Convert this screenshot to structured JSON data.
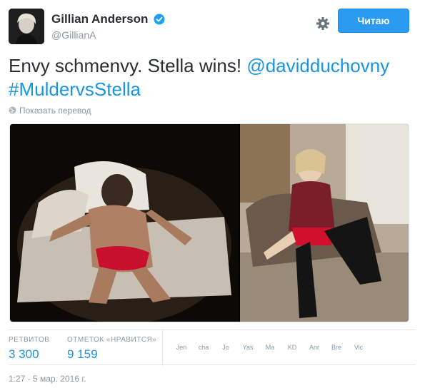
{
  "user": {
    "display_name": "Gillian Anderson",
    "handle": "@GillianA",
    "verified": true
  },
  "follow_button": {
    "label": "Читаю"
  },
  "tweet": {
    "text_plain": "Envy schmenvy. Stella wins! ",
    "mention": "@davidduchovny",
    "hashtag": "#MuldervsStella"
  },
  "translate_label": "Показать перевод",
  "stats": {
    "retweets_label": "РЕТВИТОВ",
    "retweets_value": "3 300",
    "likes_label": "ОТМЕТОК «НРАВИТСЯ»",
    "likes_value": "9 159"
  },
  "likers": [
    "Jen",
    "cha",
    "Jo",
    "Yas",
    "Ma",
    "KD",
    "Anr",
    "Bre",
    "Vic"
  ],
  "timestamp": "1:27 - 5 мар. 2016 г.",
  "colors": {
    "accent": "#1b95e0",
    "follow_bg": "#2b9bf2",
    "muted": "#8899a6"
  }
}
